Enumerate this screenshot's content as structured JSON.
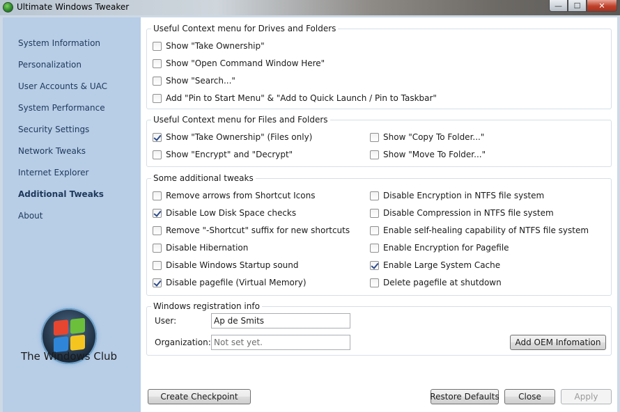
{
  "window": {
    "title": "Ultimate Windows Tweaker"
  },
  "titlebar_buttons": {
    "minimize": "—",
    "maximize": "☐",
    "close": "✕"
  },
  "sidebar": {
    "items": [
      {
        "label": "System Information"
      },
      {
        "label": "Personalization"
      },
      {
        "label": "User Accounts & UAC"
      },
      {
        "label": "System Performance"
      },
      {
        "label": "Security Settings"
      },
      {
        "label": "Network Tweaks"
      },
      {
        "label": "Internet Explorer"
      },
      {
        "label": "Additional Tweaks",
        "active": true
      },
      {
        "label": "About"
      }
    ],
    "logo_text": "The Windows Club"
  },
  "drives_group": {
    "title": "Useful Context menu for Drives and Folders",
    "items": [
      {
        "label": "Show \"Take Ownership\"",
        "checked": false
      },
      {
        "label": "Show \"Open Command Window Here\"",
        "checked": false
      },
      {
        "label": "Show \"Search...\"",
        "checked": false
      },
      {
        "label": "Add \"Pin to Start Menu\" & \"Add to Quick Launch / Pin to Taskbar\"",
        "checked": false
      }
    ]
  },
  "files_group": {
    "title": "Useful Context menu for Files and Folders",
    "items": [
      {
        "label": "Show \"Take Ownership\" (Files only)",
        "checked": true
      },
      {
        "label": "Show \"Encrypt\" and \"Decrypt\"",
        "checked": false
      },
      {
        "label": "Show \"Copy To Folder...\"",
        "checked": false
      },
      {
        "label": "Show \"Move To Folder...\"",
        "checked": false
      }
    ]
  },
  "tweaks_group": {
    "title": "Some additional tweaks",
    "items": [
      {
        "label": "Remove arrows from Shortcut Icons",
        "checked": false
      },
      {
        "label": "Disable Low Disk Space checks",
        "checked": true
      },
      {
        "label": "Remove \"-Shortcut\" suffix for new shortcuts",
        "checked": false
      },
      {
        "label": "Disable Hibernation",
        "checked": false
      },
      {
        "label": "Disable Windows Startup sound",
        "checked": false
      },
      {
        "label": "Disable pagefile (Virtual Memory)",
        "checked": true
      },
      {
        "label": "Disable Encryption in NTFS file system",
        "checked": false
      },
      {
        "label": "Disable Compression in NTFS file system",
        "checked": false
      },
      {
        "label": "Enable self-healing capability of NTFS file system",
        "checked": false
      },
      {
        "label": "Enable Encryption for Pagefile",
        "checked": false
      },
      {
        "label": "Enable Large System Cache",
        "checked": true
      },
      {
        "label": "Delete pagefile at shutdown",
        "checked": false
      }
    ]
  },
  "registration": {
    "title": "Windows registration info",
    "user_label": "User:",
    "user_value": "Ap de Smits",
    "org_label": "Organization:",
    "org_placeholder": "Not set yet.",
    "oem_button": "Add OEM Infomation"
  },
  "footer": {
    "checkpoint": "Create Checkpoint",
    "restore": "Restore Defaults",
    "close": "Close",
    "apply": "Apply"
  }
}
